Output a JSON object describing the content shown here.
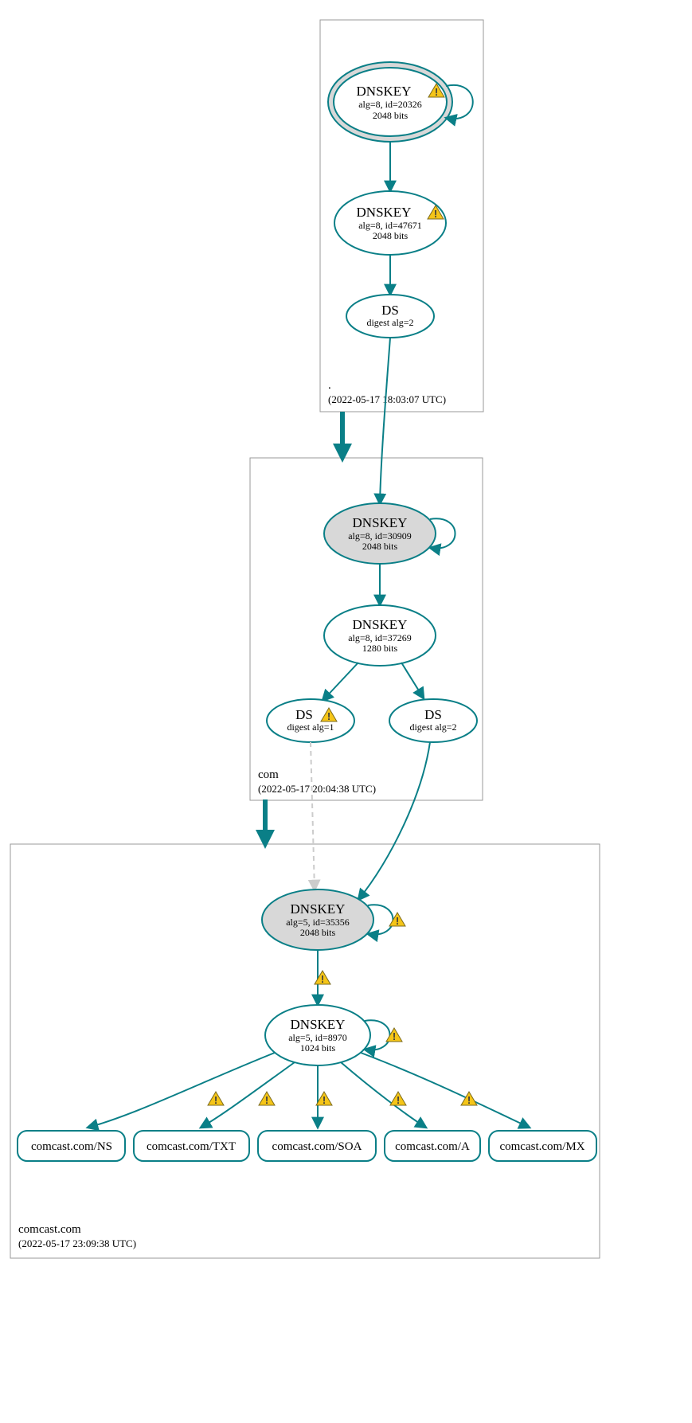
{
  "zones": {
    "root": {
      "label": ".",
      "timestamp": "(2022-05-17 18:03:07 UTC)"
    },
    "com": {
      "label": "com",
      "timestamp": "(2022-05-17 20:04:38 UTC)"
    },
    "comcast": {
      "label": "comcast.com",
      "timestamp": "(2022-05-17 23:09:38 UTC)"
    }
  },
  "nodes": {
    "root_ksk": {
      "title": "DNSKEY",
      "line1": "alg=8, id=20326",
      "line2": "2048 bits"
    },
    "root_zsk": {
      "title": "DNSKEY",
      "line1": "alg=8, id=47671",
      "line2": "2048 bits"
    },
    "root_ds": {
      "title": "DS",
      "line1": "digest alg=2"
    },
    "com_ksk": {
      "title": "DNSKEY",
      "line1": "alg=8, id=30909",
      "line2": "2048 bits"
    },
    "com_zsk": {
      "title": "DNSKEY",
      "line1": "alg=8, id=37269",
      "line2": "1280 bits"
    },
    "com_ds1": {
      "title": "DS",
      "line1": "digest alg=1"
    },
    "com_ds2": {
      "title": "DS",
      "line1": "digest alg=2"
    },
    "cc_ksk": {
      "title": "DNSKEY",
      "line1": "alg=5, id=35356",
      "line2": "2048 bits"
    },
    "cc_zsk": {
      "title": "DNSKEY",
      "line1": "alg=5, id=8970",
      "line2": "1024 bits"
    }
  },
  "rr": {
    "ns": "comcast.com/NS",
    "txt": "comcast.com/TXT",
    "soa": "comcast.com/SOA",
    "a": "comcast.com/A",
    "mx": "comcast.com/MX"
  },
  "icons": {
    "warn": "!"
  }
}
